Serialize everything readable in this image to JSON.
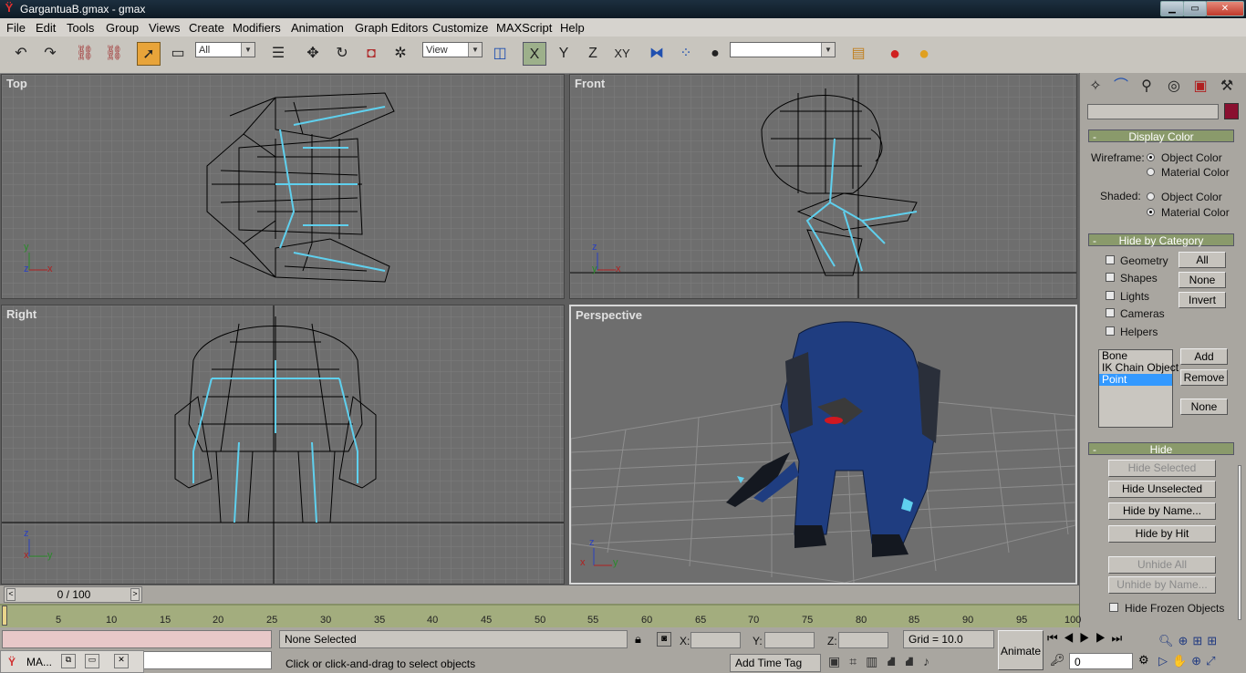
{
  "window": {
    "title": "GargantuaB.gmax - gmax",
    "icon": "gmax-logo-icon",
    "min_label": "▁",
    "max_label": "▭",
    "close_label": "✕"
  },
  "menu": [
    "File",
    "Edit",
    "Tools",
    "Group",
    "Views",
    "Create",
    "Modifiers",
    "Animation",
    "Graph Editors",
    "Customize",
    "MAXScript",
    "Help"
  ],
  "toolbar": {
    "selection_filter": "All",
    "coordinate_system": "View",
    "axis_x": "X",
    "axis_y": "Y",
    "axis_z": "Z",
    "axis_xy": "XY",
    "named_selection": ""
  },
  "viewports": {
    "top": "Top",
    "front": "Front",
    "right": "Right",
    "perspective": "Perspective",
    "axis_x": "x",
    "axis_y": "y",
    "axis_z": "z"
  },
  "command_panel": {
    "object_name": "",
    "object_color": "#8a1030",
    "display_color": {
      "title": "Display Color",
      "wireframe_label": "Wireframe:",
      "shaded_label": "Shaded:",
      "object_color": "Object Color",
      "material_color": "Material Color"
    },
    "hide_by_category": {
      "title": "Hide by Category",
      "categories": [
        "Geometry",
        "Shapes",
        "Lights",
        "Cameras",
        "Helpers"
      ],
      "all": "All",
      "none": "None",
      "invert": "Invert",
      "list": [
        "Bone",
        "IK Chain Object",
        "Point"
      ],
      "selected": "Point",
      "add": "Add",
      "remove": "Remove",
      "none2": "None"
    },
    "hide": {
      "title": "Hide",
      "hide_selected": "Hide Selected",
      "hide_unselected": "Hide Unselected",
      "hide_by_name": "Hide by Name...",
      "hide_by_hit": "Hide by Hit",
      "unhide_all": "Unhide All",
      "unhide_by_name": "Unhide by Name...",
      "hide_frozen": "Hide Frozen Objects"
    }
  },
  "timeline": {
    "frame": "0 / 100",
    "ticks": [
      "5",
      "10",
      "15",
      "20",
      "25",
      "30",
      "35",
      "40",
      "45",
      "50",
      "55",
      "60",
      "65",
      "70",
      "75",
      "80",
      "85",
      "90",
      "95",
      "100"
    ]
  },
  "status": {
    "selection": "None Selected",
    "prompt": "Click or click-and-drag to select objects",
    "x_label": "X:",
    "y_label": "Y:",
    "z_label": "Z:",
    "grid": "Grid = 10.0",
    "add_time_tag": "Add Time Tag",
    "animate": "Animate",
    "current_frame": "0"
  },
  "taskbar": {
    "label": "MA..."
  },
  "colors": {
    "wire": "#000000",
    "bones": "#5fd0ee",
    "model_blue": "#1c3a7a",
    "grid": "#8a8a8a"
  }
}
